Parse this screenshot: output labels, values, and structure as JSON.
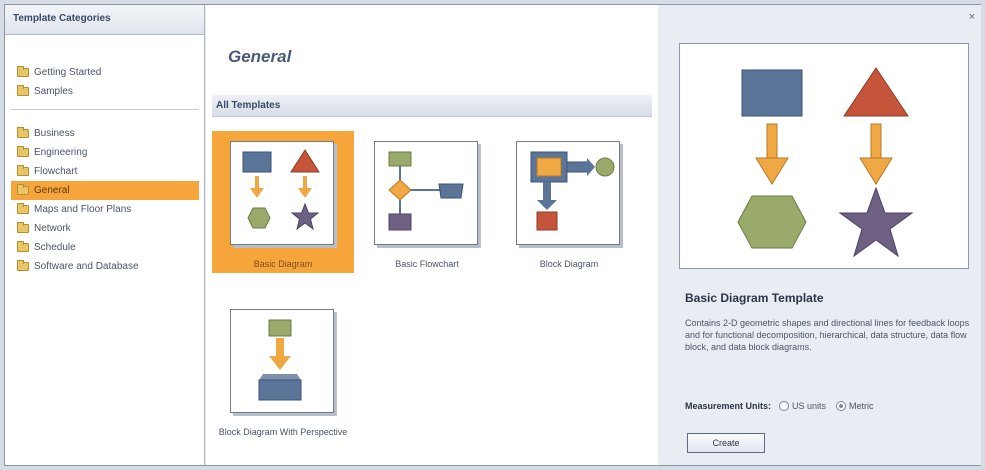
{
  "left_panel": {
    "header": "Template Categories",
    "group1": [
      {
        "label": "Getting Started"
      },
      {
        "label": "Samples"
      }
    ],
    "group2": [
      {
        "label": "Business"
      },
      {
        "label": "Engineering"
      },
      {
        "label": "Flowchart"
      },
      {
        "label": "General",
        "selected": true
      },
      {
        "label": "Maps and Floor Plans"
      },
      {
        "label": "Network"
      },
      {
        "label": "Schedule"
      },
      {
        "label": "Software and Database"
      }
    ]
  },
  "middle_panel": {
    "title": "General",
    "section": "All Templates",
    "templates": [
      {
        "label": "Basic Diagram",
        "selected": true
      },
      {
        "label": "Basic Flowchart"
      },
      {
        "label": "Block Diagram"
      },
      {
        "label": "Block Diagram With Perspective"
      }
    ]
  },
  "right_panel": {
    "close": "×",
    "template_title": "Basic Diagram Template",
    "description": "Contains 2-D geometric shapes and directional lines for feedback loops and for functional decomposition, hierarchical, data structure, data flow block, and data block diagrams.",
    "units_label": "Measurement Units:",
    "units_options": [
      {
        "label": "US units",
        "checked": false
      },
      {
        "label": "Metric",
        "checked": true
      }
    ],
    "create_label": "Create"
  },
  "colors": {
    "selection": "#f5a53a",
    "shape_blue": "#5b7598",
    "shape_red": "#c5553a",
    "shape_green": "#9aaa6a",
    "shape_purple": "#6e6082",
    "arrow_orange": "#f0a845"
  }
}
